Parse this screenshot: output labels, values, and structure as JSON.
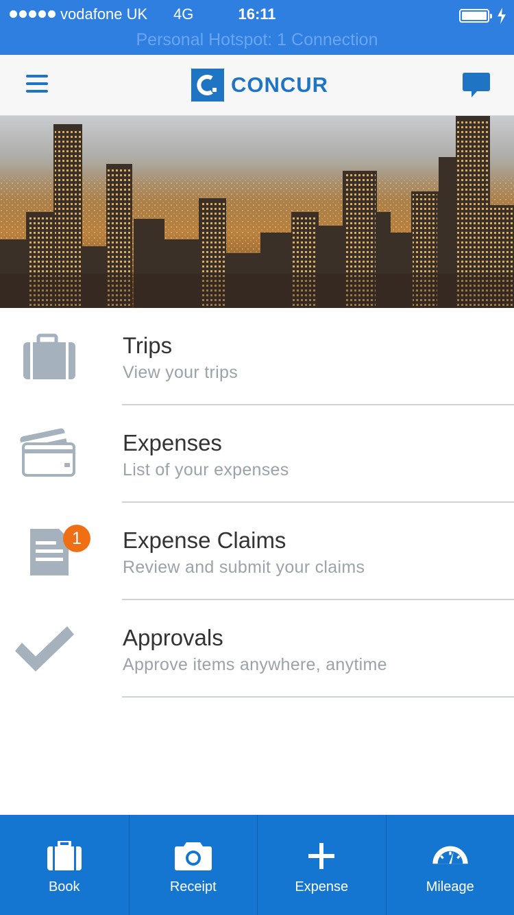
{
  "status_bar": {
    "carrier": "vodafone UK",
    "network": "4G",
    "time": "16:11",
    "hotspot": "Personal Hotspot: 1 Connection"
  },
  "header": {
    "brand": "CONCUR",
    "menu_icon": "hamburger-icon",
    "chat_icon": "chat-bubble-icon"
  },
  "menu": [
    {
      "title": "Trips",
      "subtitle": "View your trips",
      "icon": "briefcase-icon"
    },
    {
      "title": "Expenses",
      "subtitle": "List of your expenses",
      "icon": "credit-card-icon"
    },
    {
      "title": "Expense Claims",
      "subtitle": "Review and submit your claims",
      "icon": "document-icon",
      "badge": "1"
    },
    {
      "title": "Approvals",
      "subtitle": "Approve items anywhere, anytime",
      "icon": "checkmark-icon"
    }
  ],
  "tabs": [
    {
      "label": "Book",
      "icon": "briefcase-icon"
    },
    {
      "label": "Receipt",
      "icon": "camera-icon"
    },
    {
      "label": "Expense",
      "icon": "plus-icon"
    },
    {
      "label": "Mileage",
      "icon": "speedometer-icon"
    }
  ],
  "colors": {
    "status_bar": "#2e7fe0",
    "brand_blue": "#1f74c4",
    "tab_bar": "#1576d1",
    "badge": "#f06f15",
    "icon_grey": "#a5b1bd"
  }
}
